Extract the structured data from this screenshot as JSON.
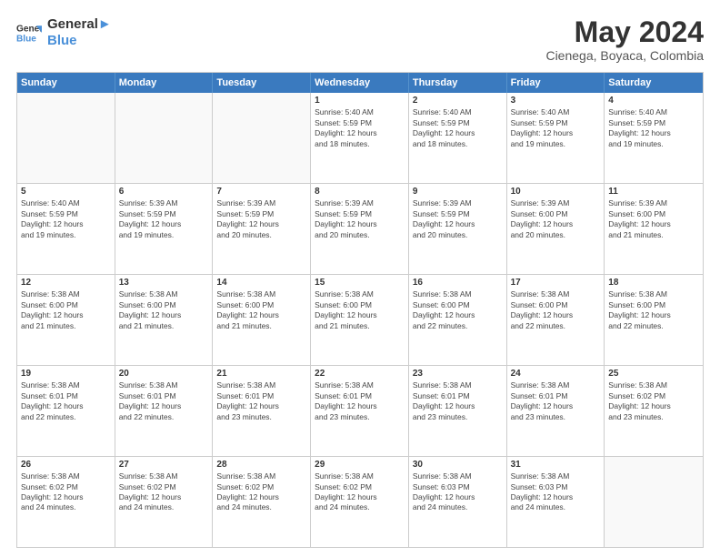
{
  "header": {
    "logo_line1": "General",
    "logo_line2": "Blue",
    "main_title": "May 2024",
    "subtitle": "Cienega, Boyaca, Colombia"
  },
  "day_labels": [
    "Sunday",
    "Monday",
    "Tuesday",
    "Wednesday",
    "Thursday",
    "Friday",
    "Saturday"
  ],
  "weeks": [
    [
      {
        "num": "",
        "info": "",
        "empty": true
      },
      {
        "num": "",
        "info": "",
        "empty": true
      },
      {
        "num": "",
        "info": "",
        "empty": true
      },
      {
        "num": "1",
        "info": "Sunrise: 5:40 AM\nSunset: 5:59 PM\nDaylight: 12 hours\nand 18 minutes.",
        "empty": false
      },
      {
        "num": "2",
        "info": "Sunrise: 5:40 AM\nSunset: 5:59 PM\nDaylight: 12 hours\nand 18 minutes.",
        "empty": false
      },
      {
        "num": "3",
        "info": "Sunrise: 5:40 AM\nSunset: 5:59 PM\nDaylight: 12 hours\nand 19 minutes.",
        "empty": false
      },
      {
        "num": "4",
        "info": "Sunrise: 5:40 AM\nSunset: 5:59 PM\nDaylight: 12 hours\nand 19 minutes.",
        "empty": false
      }
    ],
    [
      {
        "num": "5",
        "info": "Sunrise: 5:40 AM\nSunset: 5:59 PM\nDaylight: 12 hours\nand 19 minutes.",
        "empty": false
      },
      {
        "num": "6",
        "info": "Sunrise: 5:39 AM\nSunset: 5:59 PM\nDaylight: 12 hours\nand 19 minutes.",
        "empty": false
      },
      {
        "num": "7",
        "info": "Sunrise: 5:39 AM\nSunset: 5:59 PM\nDaylight: 12 hours\nand 20 minutes.",
        "empty": false
      },
      {
        "num": "8",
        "info": "Sunrise: 5:39 AM\nSunset: 5:59 PM\nDaylight: 12 hours\nand 20 minutes.",
        "empty": false
      },
      {
        "num": "9",
        "info": "Sunrise: 5:39 AM\nSunset: 5:59 PM\nDaylight: 12 hours\nand 20 minutes.",
        "empty": false
      },
      {
        "num": "10",
        "info": "Sunrise: 5:39 AM\nSunset: 6:00 PM\nDaylight: 12 hours\nand 20 minutes.",
        "empty": false
      },
      {
        "num": "11",
        "info": "Sunrise: 5:39 AM\nSunset: 6:00 PM\nDaylight: 12 hours\nand 21 minutes.",
        "empty": false
      }
    ],
    [
      {
        "num": "12",
        "info": "Sunrise: 5:38 AM\nSunset: 6:00 PM\nDaylight: 12 hours\nand 21 minutes.",
        "empty": false
      },
      {
        "num": "13",
        "info": "Sunrise: 5:38 AM\nSunset: 6:00 PM\nDaylight: 12 hours\nand 21 minutes.",
        "empty": false
      },
      {
        "num": "14",
        "info": "Sunrise: 5:38 AM\nSunset: 6:00 PM\nDaylight: 12 hours\nand 21 minutes.",
        "empty": false
      },
      {
        "num": "15",
        "info": "Sunrise: 5:38 AM\nSunset: 6:00 PM\nDaylight: 12 hours\nand 21 minutes.",
        "empty": false
      },
      {
        "num": "16",
        "info": "Sunrise: 5:38 AM\nSunset: 6:00 PM\nDaylight: 12 hours\nand 22 minutes.",
        "empty": false
      },
      {
        "num": "17",
        "info": "Sunrise: 5:38 AM\nSunset: 6:00 PM\nDaylight: 12 hours\nand 22 minutes.",
        "empty": false
      },
      {
        "num": "18",
        "info": "Sunrise: 5:38 AM\nSunset: 6:00 PM\nDaylight: 12 hours\nand 22 minutes.",
        "empty": false
      }
    ],
    [
      {
        "num": "19",
        "info": "Sunrise: 5:38 AM\nSunset: 6:01 PM\nDaylight: 12 hours\nand 22 minutes.",
        "empty": false
      },
      {
        "num": "20",
        "info": "Sunrise: 5:38 AM\nSunset: 6:01 PM\nDaylight: 12 hours\nand 22 minutes.",
        "empty": false
      },
      {
        "num": "21",
        "info": "Sunrise: 5:38 AM\nSunset: 6:01 PM\nDaylight: 12 hours\nand 23 minutes.",
        "empty": false
      },
      {
        "num": "22",
        "info": "Sunrise: 5:38 AM\nSunset: 6:01 PM\nDaylight: 12 hours\nand 23 minutes.",
        "empty": false
      },
      {
        "num": "23",
        "info": "Sunrise: 5:38 AM\nSunset: 6:01 PM\nDaylight: 12 hours\nand 23 minutes.",
        "empty": false
      },
      {
        "num": "24",
        "info": "Sunrise: 5:38 AM\nSunset: 6:01 PM\nDaylight: 12 hours\nand 23 minutes.",
        "empty": false
      },
      {
        "num": "25",
        "info": "Sunrise: 5:38 AM\nSunset: 6:02 PM\nDaylight: 12 hours\nand 23 minutes.",
        "empty": false
      }
    ],
    [
      {
        "num": "26",
        "info": "Sunrise: 5:38 AM\nSunset: 6:02 PM\nDaylight: 12 hours\nand 24 minutes.",
        "empty": false
      },
      {
        "num": "27",
        "info": "Sunrise: 5:38 AM\nSunset: 6:02 PM\nDaylight: 12 hours\nand 24 minutes.",
        "empty": false
      },
      {
        "num": "28",
        "info": "Sunrise: 5:38 AM\nSunset: 6:02 PM\nDaylight: 12 hours\nand 24 minutes.",
        "empty": false
      },
      {
        "num": "29",
        "info": "Sunrise: 5:38 AM\nSunset: 6:02 PM\nDaylight: 12 hours\nand 24 minutes.",
        "empty": false
      },
      {
        "num": "30",
        "info": "Sunrise: 5:38 AM\nSunset: 6:03 PM\nDaylight: 12 hours\nand 24 minutes.",
        "empty": false
      },
      {
        "num": "31",
        "info": "Sunrise: 5:38 AM\nSunset: 6:03 PM\nDaylight: 12 hours\nand 24 minutes.",
        "empty": false
      },
      {
        "num": "",
        "info": "",
        "empty": true
      }
    ]
  ]
}
